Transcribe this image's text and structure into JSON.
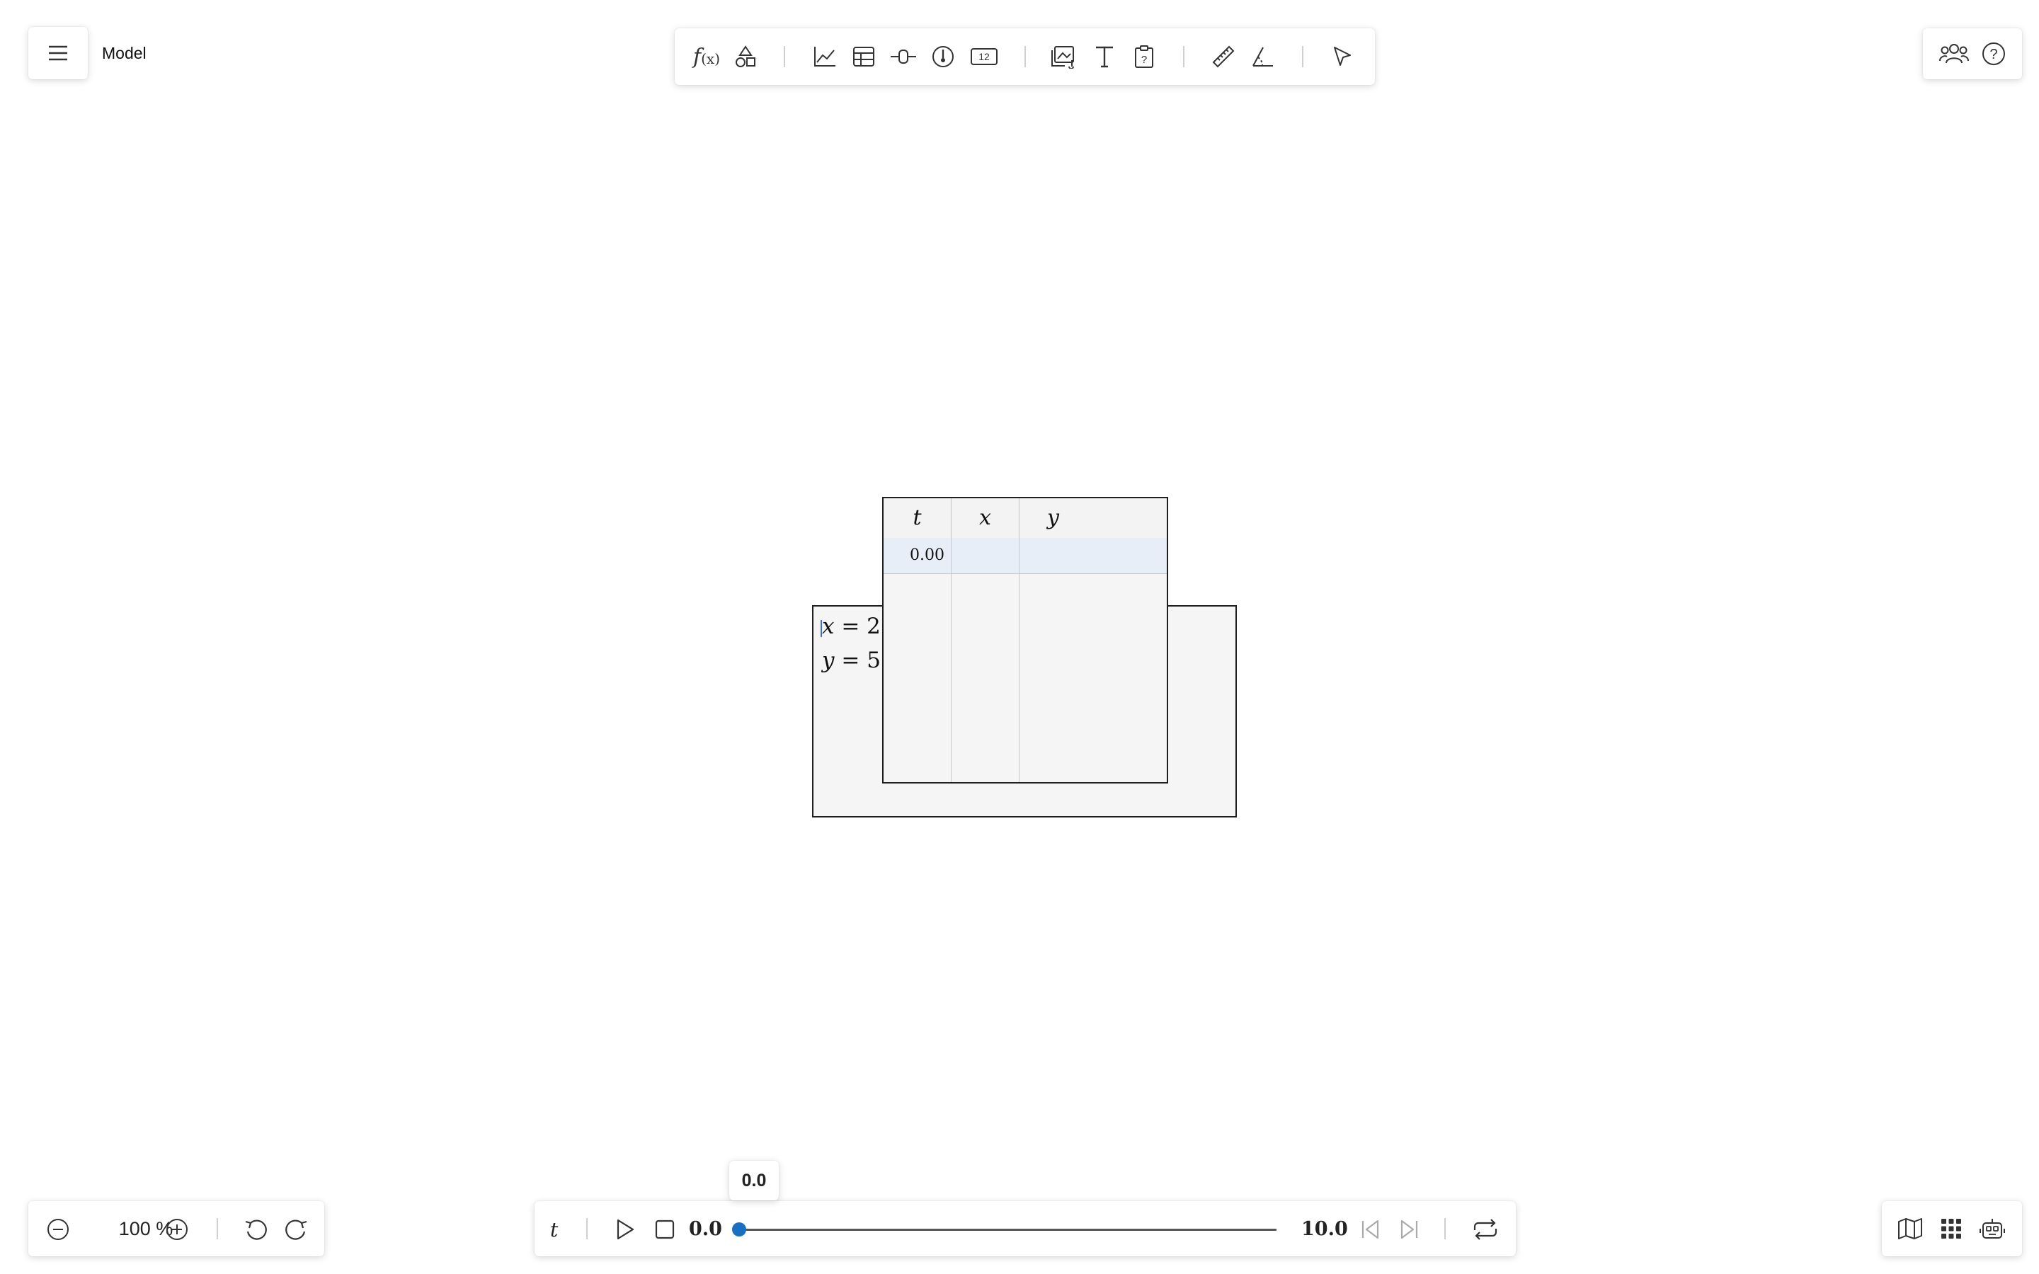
{
  "app": {
    "document_title": "Model"
  },
  "toolbar": {
    "tools": [
      {
        "name": "function",
        "glyph": "f(x)"
      },
      {
        "name": "shapes"
      },
      {
        "name": "graph"
      },
      {
        "name": "table"
      },
      {
        "name": "slider"
      },
      {
        "name": "gauge"
      },
      {
        "name": "value-display",
        "glyph": "12"
      },
      {
        "name": "media"
      },
      {
        "name": "text",
        "glyph": "T"
      },
      {
        "name": "question"
      },
      {
        "name": "ruler"
      },
      {
        "name": "protractor"
      },
      {
        "name": "select"
      }
    ]
  },
  "model": {
    "equations": [
      {
        "var": "x",
        "value": "2"
      },
      {
        "var": "y",
        "value": "5"
      }
    ]
  },
  "table": {
    "columns": [
      "t",
      "x",
      "y"
    ],
    "rows": [
      {
        "t": "0.00",
        "x": "",
        "y": ""
      }
    ]
  },
  "zoom": {
    "value": "100 %"
  },
  "time": {
    "variable": "t",
    "current": "0.0",
    "start": "0.0",
    "end": "10.0",
    "progress": 0.0,
    "tooltip": "0.0"
  },
  "colors": {
    "accent": "#1a6fc1",
    "selected_row": "#e8eef8",
    "panel_bg": "#f5f5f5"
  }
}
